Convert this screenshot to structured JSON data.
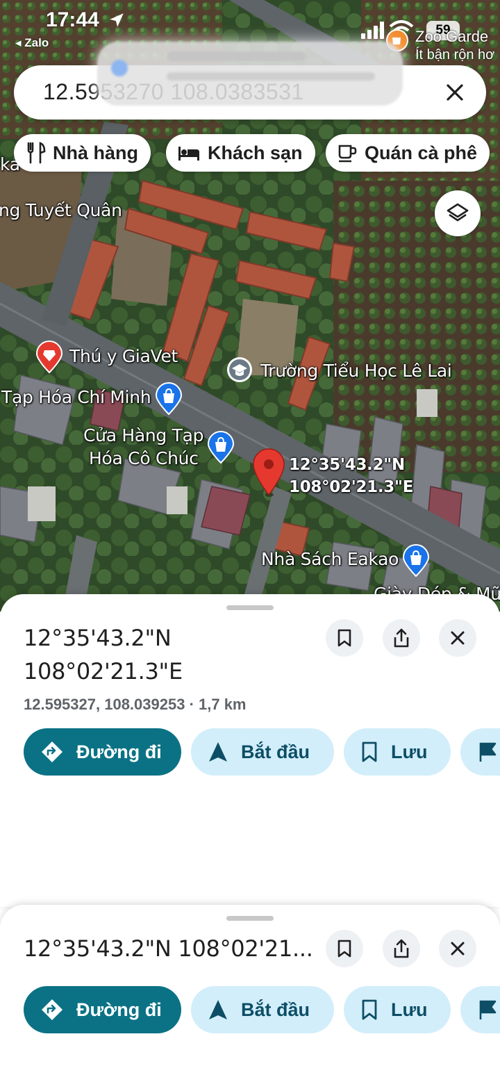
{
  "status_bar": {
    "time": "17:44",
    "back_app": "◂ Zalo",
    "battery": "59",
    "nearby_place": "Zoo Garde",
    "nearby_sub": "Ít bận rộn hơ"
  },
  "search": {
    "query": "12.5953270 108.0383531"
  },
  "chips": [
    {
      "label": "Nhà hàng",
      "icon": "restaurant-icon"
    },
    {
      "label": "Khách sạn",
      "icon": "hotel-icon"
    },
    {
      "label": "Quán cà phê",
      "icon": "cafe-icon"
    }
  ],
  "map": {
    "labels": {
      "ka": "ka",
      "tuyet_quan": "ng Tuyết Quân",
      "thu_y": "Thú y GiaVet",
      "truong": "Trường Tiểu Học Lê Lai",
      "tap_hoa_chi_minh": "Tạp Hóa Chí Minh",
      "cua_hang_line1": "Cửa Hàng Tạp",
      "cua_hang_line2": "Hóa Cô Chúc",
      "pin_lat": "12°35'43.2\"N",
      "pin_lng": "108°02'21.3\"E",
      "nha_sach": "Nhà Sách Eakao",
      "giay_dep": "Giày Dép & Mũ"
    },
    "colors": {
      "pin": "#e5392f",
      "poi_shop": "#1a73e8",
      "poi_vet": "#e5392f",
      "poi_school": "#6b7a86"
    }
  },
  "sheet_expanded": {
    "title_line1": "12°35'43.2\"N",
    "title_line2": "108°02'21.3\"E",
    "subtitle": "12.595327, 108.039253 · 1,7 km",
    "actions": {
      "directions": "Đường đi",
      "start": "Bắt đầu",
      "save": "Lưu"
    }
  },
  "sheet_collapsed": {
    "title": "12°35'43.2\"N 108°02'21...",
    "actions": {
      "directions": "Đường đi",
      "start": "Bắt đầu",
      "save": "Lưu"
    }
  },
  "colors": {
    "primary": "#0b7285",
    "secondary_bg": "#d2eefa",
    "secondary_text": "#0d4e66"
  }
}
